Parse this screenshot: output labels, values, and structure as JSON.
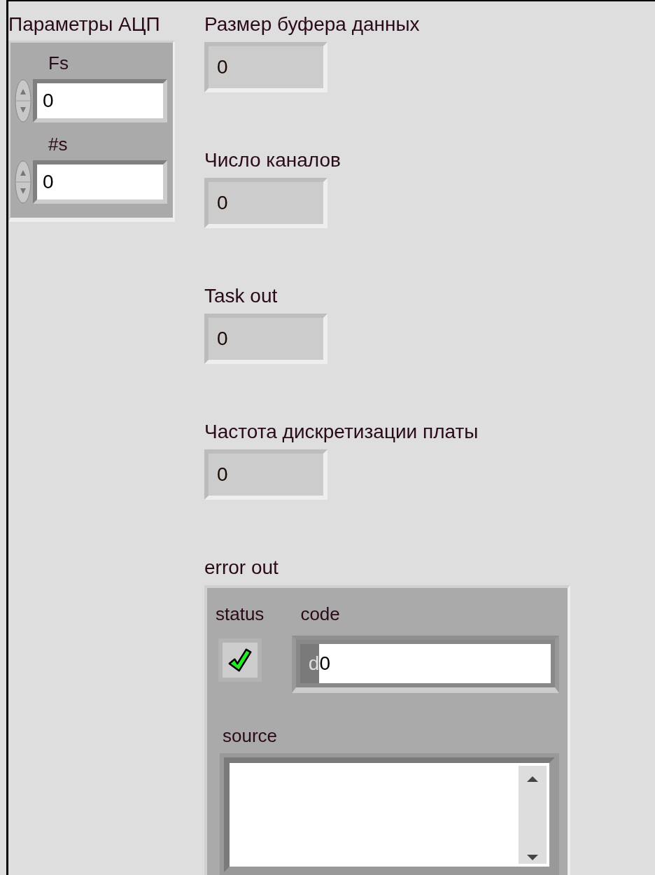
{
  "adc_params": {
    "label": "Параметры АЦП",
    "controls": [
      {
        "label": "Fs",
        "value": "0"
      },
      {
        "label": "#s",
        "value": "0"
      }
    ]
  },
  "indicators": [
    {
      "label": "Размер буфера данных",
      "value": "0"
    },
    {
      "label": "Число каналов",
      "value": "0"
    },
    {
      "label": "Task out",
      "value": "0"
    },
    {
      "label": "Частота дискретизации платы",
      "value": "0"
    }
  ],
  "error_out": {
    "label": "error out",
    "status": {
      "label": "status",
      "checked": true
    },
    "code": {
      "label": "code",
      "radix": "d",
      "value": "0"
    },
    "source": {
      "label": "source"
    }
  }
}
